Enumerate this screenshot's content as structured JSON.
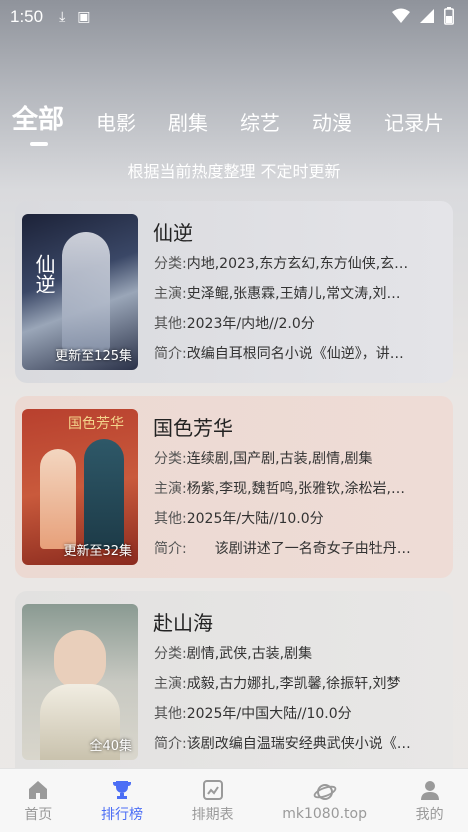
{
  "status_bar": {
    "time": "1:50"
  },
  "tabs": [
    "全部",
    "电影",
    "剧集",
    "综艺",
    "动漫",
    "记录片"
  ],
  "subtitle": "根据当前热度整理 不定时更新",
  "cards": [
    {
      "title": "仙逆",
      "category_label": "分类:",
      "category": "内地,2023,东方玄幻,东方仙侠,玄…",
      "cast_label": "主演:",
      "cast": "史泽鲲,张惠霖,王婧儿,常文涛,刘…",
      "other_label": "其他:",
      "other": "2023年/内地//2.0分",
      "intro_label": "简介:",
      "intro": "改编自耳根同名小说《仙逆》，讲…",
      "badge": "更新至125集",
      "poster_text": "仙逆"
    },
    {
      "title": "国色芳华",
      "category_label": "分类:",
      "category": "连续剧,国产剧,古装,剧情,剧集",
      "cast_label": "主演:",
      "cast": "杨紫,李现,魏哲鸣,张雅钦,涂松岩,…",
      "other_label": "其他:",
      "other": "2025年/大陆//10.0分",
      "intro_label": "简介:",
      "intro": "　　该剧讲述了一名奇女子由牡丹…",
      "badge": "更新至32集",
      "poster_text": "国色芳华"
    },
    {
      "title": "赴山海",
      "category_label": "分类:",
      "category": "剧情,武侠,古装,剧集",
      "cast_label": "主演:",
      "cast": "成毅,古力娜扎,李凯馨,徐振轩,刘梦",
      "other_label": "其他:",
      "other": "2025年/中国大陆//10.0分",
      "intro_label": "简介:",
      "intro": "该剧改编自温瑞安经典武侠小说《…",
      "badge": "全40集",
      "poster_text": ""
    }
  ],
  "bottom_nav": [
    {
      "label": "首页",
      "icon": "home-icon"
    },
    {
      "label": "排行榜",
      "icon": "trophy-icon"
    },
    {
      "label": "排期表",
      "icon": "schedule-icon"
    },
    {
      "label": "mk1080.top",
      "icon": "planet-icon"
    },
    {
      "label": "我的",
      "icon": "user-icon"
    }
  ],
  "colors": {
    "active": "#4c6ef5",
    "inactive": "#9a9a9a"
  }
}
